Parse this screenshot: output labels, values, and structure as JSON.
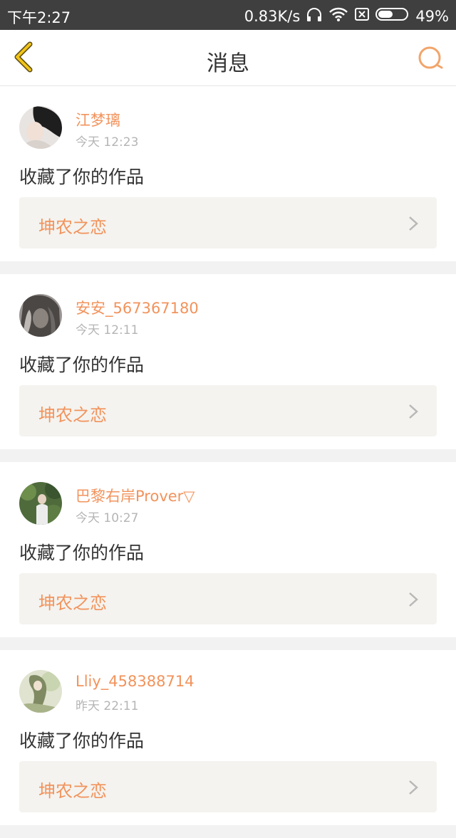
{
  "status_bar": {
    "time": "下午2:27",
    "speed": "0.83K/s",
    "battery": "49%"
  },
  "nav": {
    "title": "消息"
  },
  "colors": {
    "accent": "#f2935c",
    "back_icon": "#f0c419",
    "search_icon": "#f2a56a"
  },
  "messages": [
    {
      "username": "江梦璃",
      "time": "今天 12:23",
      "action": "收藏了你的作品",
      "work": "坤农之恋"
    },
    {
      "username": "安安_567367180",
      "time": "今天 12:11",
      "action": "收藏了你的作品",
      "work": "坤农之恋"
    },
    {
      "username": "巴黎右岸Prover▽",
      "time": "今天 10:27",
      "action": "收藏了你的作品",
      "work": "坤农之恋"
    },
    {
      "username": "Lliy_458388714",
      "time": "昨天 22:11",
      "action": "收藏了你的作品",
      "work": "坤农之恋"
    }
  ]
}
